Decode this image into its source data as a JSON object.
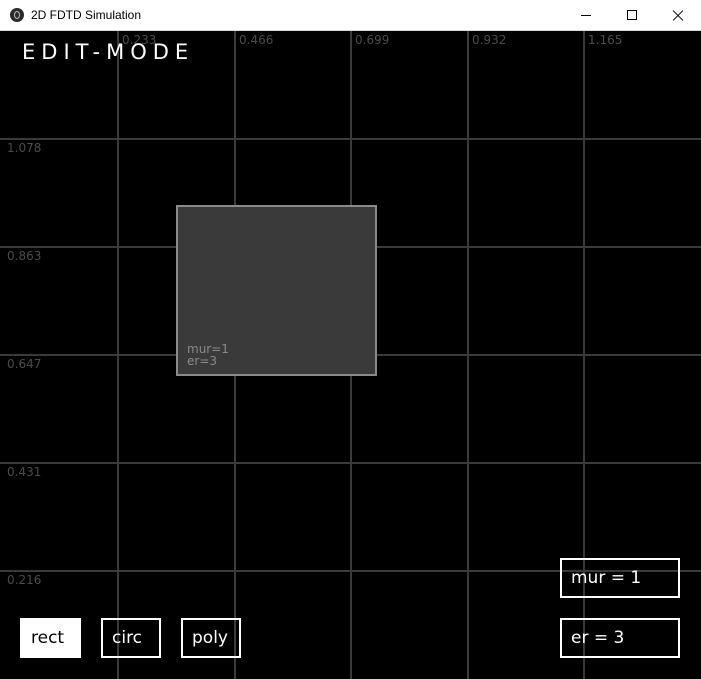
{
  "window": {
    "title": "2D FDTD Simulation",
    "icon": "app-icon"
  },
  "canvas": {
    "mode_title": "EDIT-MODE",
    "x_ticks": [
      "0.233",
      "0.466",
      "0.699",
      "0.932",
      "1.165"
    ],
    "y_ticks": [
      "1.078",
      "0.863",
      "0.647",
      "0.431",
      "0.216"
    ],
    "shape": {
      "type": "rect",
      "mur_label": "mur=1",
      "er_label": "er=3"
    }
  },
  "toolbar": {
    "rect_label": "rect",
    "circ_label": "circ",
    "poly_label": "poly",
    "selected": "rect"
  },
  "params": {
    "mur_label": "mur = 1",
    "er_label": "er = 3"
  },
  "colors": {
    "background": "#000000",
    "grid": "#3a3a3a",
    "shape_fill": "#3a3a3a",
    "shape_border": "#8a8a8a",
    "foreground": "#ffffff"
  }
}
